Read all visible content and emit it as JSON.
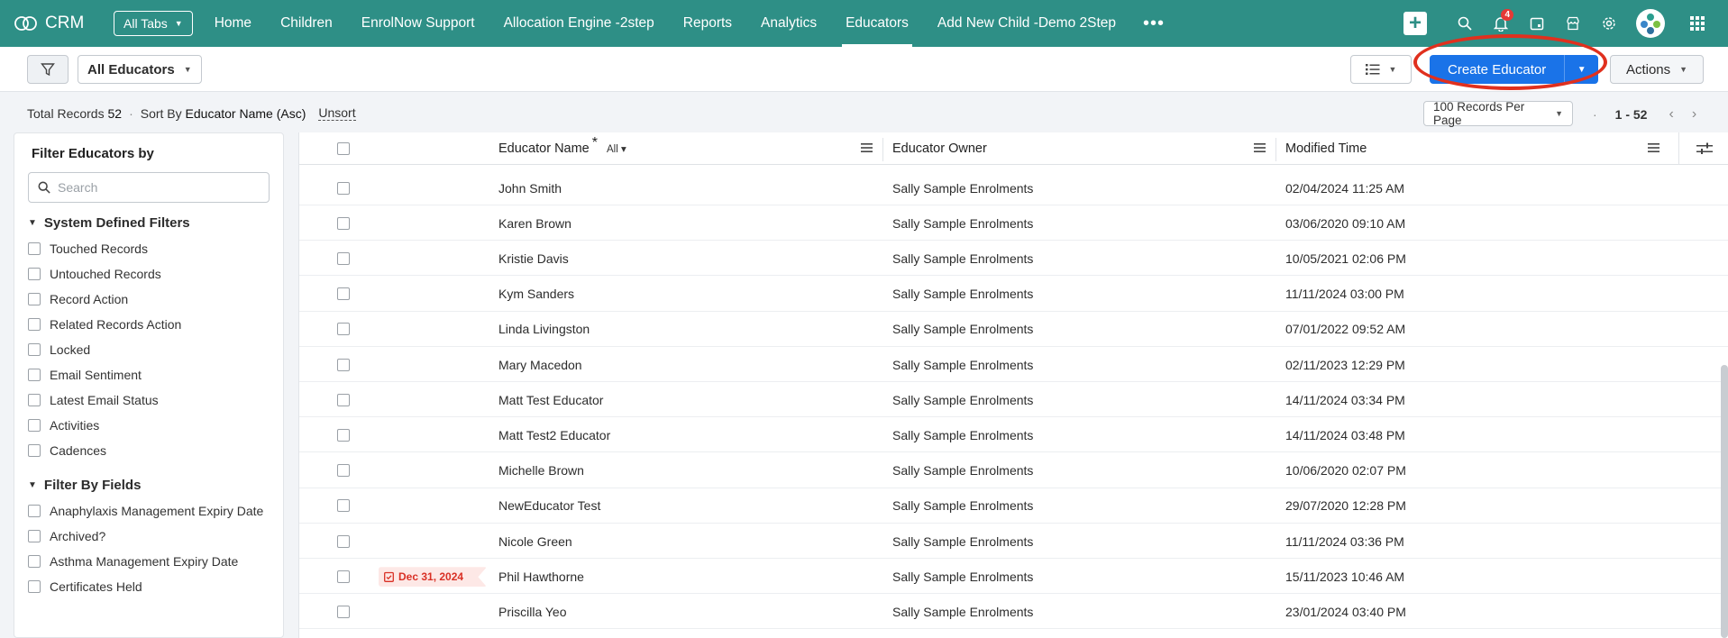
{
  "brand": {
    "name": "CRM"
  },
  "nav": {
    "all_tabs_label": "All Tabs",
    "tabs": [
      "Home",
      "Children",
      "EnrolNow Support",
      "Allocation Engine -2step",
      "Reports",
      "Analytics",
      "Educators",
      "Add New Child -Demo 2Step"
    ],
    "active_tab": "Educators",
    "notification_count": "4"
  },
  "toolbar": {
    "view_label": "All Educators",
    "create_label": "Create Educator",
    "actions_label": "Actions"
  },
  "records": {
    "total_label": "Total Records",
    "total_value": "52",
    "sort_label": "Sort By",
    "sort_value": "Educator Name (Asc)",
    "unsort_label": "Unsort",
    "per_page": "100 Records Per Page",
    "range": "1 - 52"
  },
  "sidebar": {
    "title": "Filter Educators by",
    "search_placeholder": "Search",
    "system_section": "System Defined Filters",
    "system_filters": [
      "Touched Records",
      "Untouched Records",
      "Record Action",
      "Related Records Action",
      "Locked",
      "Email Sentiment",
      "Latest Email Status",
      "Activities",
      "Cadences"
    ],
    "fields_section": "Filter By Fields",
    "field_filters": [
      "Anaphylaxis Management Expiry Date",
      "Archived?",
      "Asthma Management Expiry Date",
      "Certificates Held"
    ]
  },
  "table": {
    "columns": {
      "name": "Educator Name",
      "name_filter": "All",
      "owner": "Educator Owner",
      "modified": "Modified Time"
    },
    "rows": [
      {
        "name": "John Smith",
        "owner": "Sally Sample Enrolments",
        "modified": "02/04/2024 11:25 AM",
        "tag": ""
      },
      {
        "name": "Karen Brown",
        "owner": "Sally Sample Enrolments",
        "modified": "03/06/2020 09:10 AM",
        "tag": ""
      },
      {
        "name": "Kristie Davis",
        "owner": "Sally Sample Enrolments",
        "modified": "10/05/2021 02:06 PM",
        "tag": ""
      },
      {
        "name": "Kym Sanders",
        "owner": "Sally Sample Enrolments",
        "modified": "11/11/2024 03:00 PM",
        "tag": ""
      },
      {
        "name": "Linda Livingston",
        "owner": "Sally Sample Enrolments",
        "modified": "07/01/2022 09:52 AM",
        "tag": ""
      },
      {
        "name": "Mary Macedon",
        "owner": "Sally Sample Enrolments",
        "modified": "02/11/2023 12:29 PM",
        "tag": ""
      },
      {
        "name": "Matt Test Educator",
        "owner": "Sally Sample Enrolments",
        "modified": "14/11/2024 03:34 PM",
        "tag": ""
      },
      {
        "name": "Matt Test2 Educator",
        "owner": "Sally Sample Enrolments",
        "modified": "14/11/2024 03:48 PM",
        "tag": ""
      },
      {
        "name": "Michelle Brown",
        "owner": "Sally Sample Enrolments",
        "modified": "10/06/2020 02:07 PM",
        "tag": ""
      },
      {
        "name": "NewEducator Test",
        "owner": "Sally Sample Enrolments",
        "modified": "29/07/2020 12:28 PM",
        "tag": ""
      },
      {
        "name": "Nicole Green",
        "owner": "Sally Sample Enrolments",
        "modified": "11/11/2024 03:36 PM",
        "tag": ""
      },
      {
        "name": "Phil Hawthorne",
        "owner": "Sally Sample Enrolments",
        "modified": "15/11/2023 10:46 AM",
        "tag": "Dec 31, 2024"
      },
      {
        "name": "Priscilla Yeo",
        "owner": "Sally Sample Enrolments",
        "modified": "23/01/2024 03:40 PM",
        "tag": ""
      }
    ]
  },
  "colors": {
    "nav_bg": "#2e8f86",
    "primary": "#1a73e8",
    "highlight": "#e0301e",
    "tag_text": "#d93025"
  }
}
